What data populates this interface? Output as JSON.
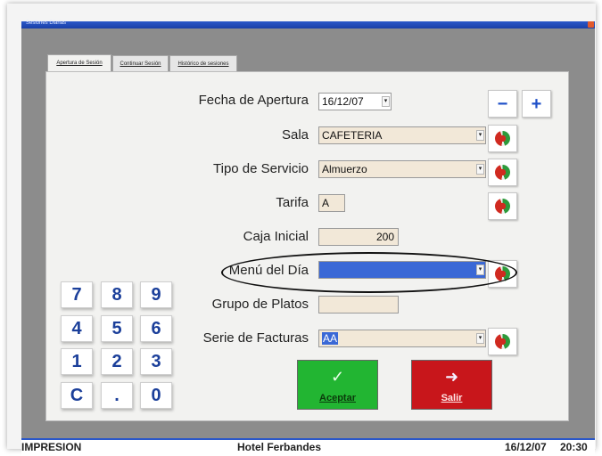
{
  "window": {
    "title": "Sesiones Diarias"
  },
  "tabs": [
    {
      "label": "Apertura de Sesión"
    },
    {
      "label": "Continuar Sesión"
    },
    {
      "label": "Histórico de sesiones"
    }
  ],
  "form": {
    "fecha_apertura": {
      "label": "Fecha de Apertura",
      "value": "16/12/07"
    },
    "sala": {
      "label": "Sala",
      "value": "CAFETERIA"
    },
    "tipo_servicio": {
      "label": "Tipo de Servicio",
      "value": "Almuerzo"
    },
    "tarifa": {
      "label": "Tarifa",
      "value": "A"
    },
    "caja_inicial": {
      "label": "Caja Inicial",
      "value": "200"
    },
    "menu_dia": {
      "label": "Menú del Día",
      "value": ""
    },
    "grupo_platos": {
      "label": "Grupo de Platos",
      "value": ""
    },
    "serie_facturas": {
      "label": "Serie de Facturas",
      "value": "AA"
    }
  },
  "zoom": {
    "minus": "−",
    "plus": "+"
  },
  "keypad": {
    "rows": [
      [
        "7",
        "8",
        "9"
      ],
      [
        "4",
        "5",
        "6"
      ],
      [
        "1",
        "2",
        "3"
      ],
      [
        "C",
        ".",
        "0"
      ]
    ]
  },
  "actions": {
    "accept": {
      "label": "Aceptar",
      "icon": "✓",
      "color": "#22b532"
    },
    "exit": {
      "label": "Salir",
      "icon": "➜",
      "color": "#c8161b"
    }
  },
  "status": {
    "left": "IMPRESION",
    "center": "Hotel Ferbandes",
    "date": "16/12/07",
    "time": "20:30"
  },
  "icons": {
    "refresh": "refresh-icon",
    "dropdown": "▾"
  },
  "colors": {
    "title": "#2a57c9",
    "field": "#f2e8d8",
    "selection": "#3a68d6"
  }
}
